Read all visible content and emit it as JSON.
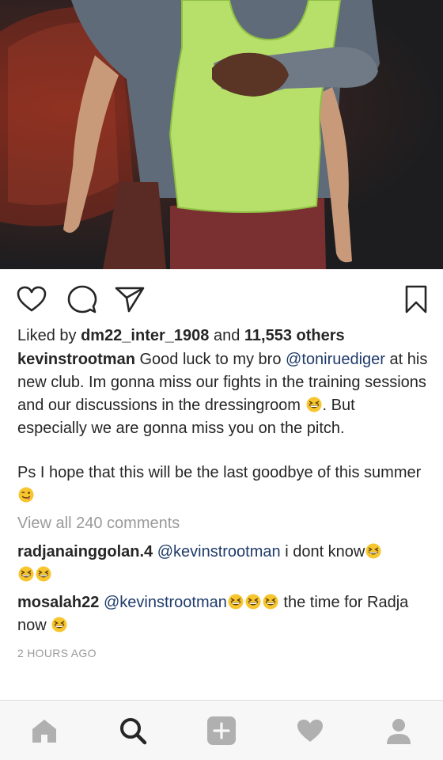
{
  "post": {
    "likes": {
      "prefix": "Liked by ",
      "user": "dm22_inter_1908",
      "middle": " and ",
      "count": "11,553 others"
    },
    "caption": {
      "user": "kevinstrootman",
      "text_1": " Good luck to my bro ",
      "mention": "@toniruediger",
      "text_2": " at his new club. Im gonna miss our fights in the training sessions  and our discussions in the dressingroom ",
      "text_3": ". But especially we are gonna miss you on the pitch.",
      "text_4": "Ps I hope that this will be the last goodbye of this summer"
    },
    "view_all_comments": "View all 240 comments",
    "comments": [
      {
        "user": "radjanainggolan.4",
        "mention": "@kevinstrootman",
        "text": " i dont know"
      },
      {
        "user": "mosalah22",
        "mention": "@kevinstrootman",
        "text_1": " the time for Radja now "
      }
    ],
    "timestamp": "2 HOURS AGO"
  },
  "icons": {
    "like": "heart-outline-icon",
    "comment": "comment-bubble-icon",
    "share": "paper-plane-icon",
    "save": "bookmark-icon",
    "emoji_laugh": "grinning-squinting-face-emoji",
    "emoji_wink": "winking-tongue-face-emoji",
    "nav": [
      "home-icon",
      "search-icon",
      "add-post-icon",
      "activity-heart-icon",
      "profile-icon"
    ]
  },
  "colors": {
    "text": "#262626",
    "muted": "#9a9a9a",
    "mention": "#1f3b6b",
    "navbar_bg": "#f7f7f7",
    "nav_inactive": "#b0b0b0",
    "nav_active": "#262626"
  }
}
